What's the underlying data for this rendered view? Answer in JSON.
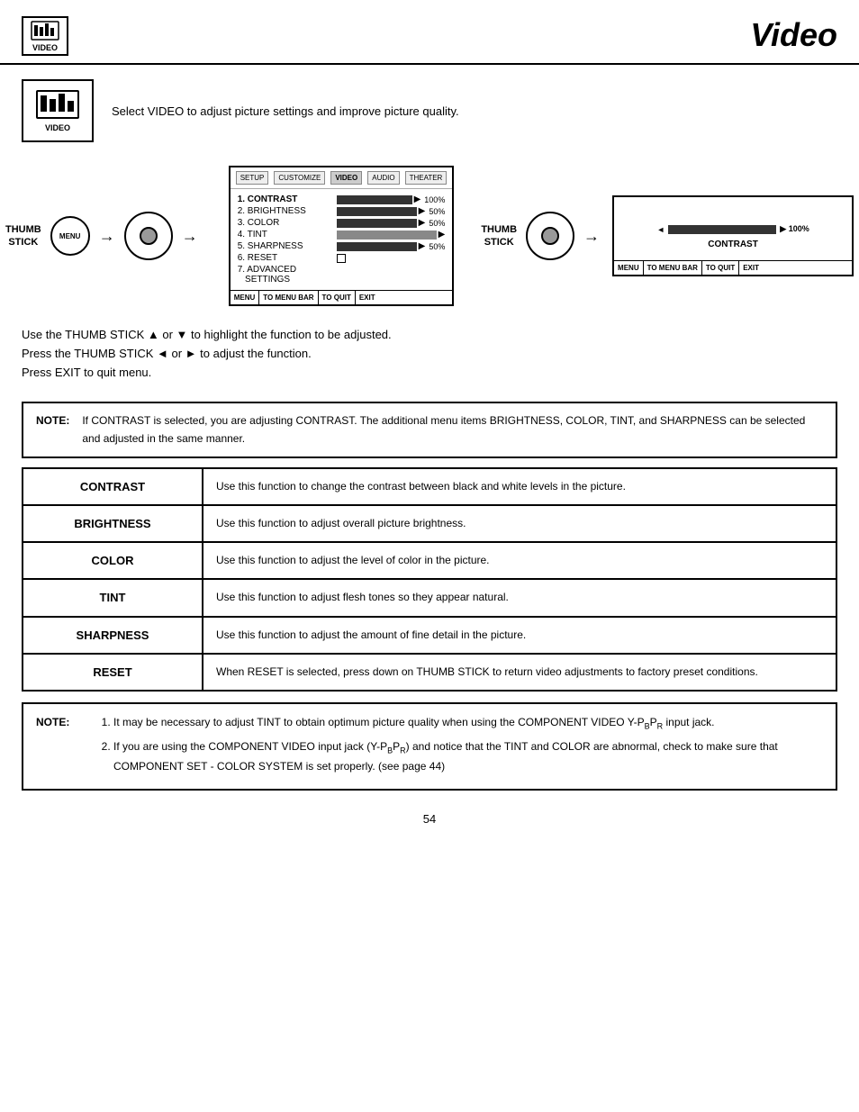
{
  "header": {
    "title": "Video",
    "icon_label": "VIDEO"
  },
  "intro": {
    "text": "Select VIDEO to adjust picture settings and improve picture quality.",
    "icon_label": "VIDEO"
  },
  "left_diagram": {
    "menu_label": "MENU",
    "thumb_stick_label": "THUMB\nSTICK"
  },
  "menu_box": {
    "tabs": [
      "SETUP",
      "CUSTOMIZE",
      "VIDEO",
      "AUDIO",
      "THEATER"
    ],
    "items": [
      {
        "number": "1.",
        "name": "CONTRAST",
        "bar": true,
        "value": "100%",
        "selected": true
      },
      {
        "number": "2.",
        "name": "BRIGHTNESS",
        "bar": true,
        "value": "50%"
      },
      {
        "number": "3.",
        "name": "COLOR",
        "bar": true,
        "value": "50%"
      },
      {
        "number": "4.",
        "name": "TINT",
        "bar": true,
        "value": ""
      },
      {
        "number": "5.",
        "name": "SHARPNESS",
        "bar": true,
        "value": "50%"
      },
      {
        "number": "6.",
        "name": "RESET",
        "checkbox": true
      },
      {
        "number": "7.",
        "name": "ADVANCED\nSETTINGS"
      }
    ],
    "footer": [
      "MENU",
      "TO MENU BAR",
      "TO QUIT",
      "EXIT"
    ]
  },
  "right_diagram": {
    "thumb_stick_label": "THUMB\nSTICK",
    "contrast_label": "CONTRAST",
    "contrast_value": "▶ 100%",
    "footer": [
      "MENU",
      "TO MENU BAR",
      "TO QUIT",
      "EXIT"
    ]
  },
  "instructions": {
    "line1": "Use the THUMB STICK ▲ or ▼ to highlight the function to be adjusted.",
    "line2": "Press the THUMB STICK ◄ or ► to adjust the function.",
    "line3": "Press EXIT to quit menu."
  },
  "note1": {
    "label": "NOTE:",
    "text": "If CONTRAST is selected, you are adjusting CONTRAST.  The additional menu items BRIGHTNESS, COLOR, TINT, and SHARPNESS can be selected and adjusted in the same manner."
  },
  "functions": [
    {
      "key": "CONTRAST",
      "desc": "Use this function to change the contrast between black and white levels in the picture."
    },
    {
      "key": "BRIGHTNESS",
      "desc": "Use this function to adjust overall picture brightness."
    },
    {
      "key": "COLOR",
      "desc": "Use this function to adjust the level of color in the picture."
    },
    {
      "key": "TINT",
      "desc": "Use this function to adjust flesh tones so they appear natural."
    },
    {
      "key": "SHARPNESS",
      "desc": "Use this function to adjust the amount of fine detail in the picture."
    },
    {
      "key": "RESET",
      "desc": "When RESET is selected, press down on THUMB STICK to return video adjustments to factory preset conditions."
    }
  ],
  "note2": {
    "label": "NOTE:",
    "items": [
      "It may be necessary to adjust TINT to obtain optimum picture quality when using the COMPONENT VIDEO Y-PBPRinput jack.",
      "If you are using the COMPONENT VIDEO input jack (Y-PBPR) and notice that the TINT and COLOR are abnormal, check to make sure that COMPONENT SET - COLOR SYSTEM is set properly. (see page 44)"
    ]
  },
  "page_number": "54"
}
